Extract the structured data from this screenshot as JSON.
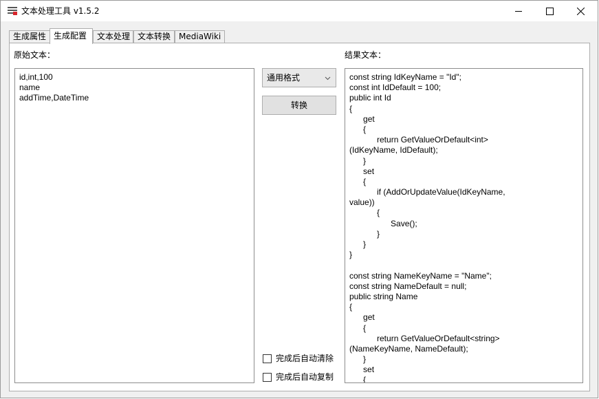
{
  "window": {
    "title": "文本处理工具 v1.5.2",
    "controls": {
      "minimize": "minimize",
      "maximize": "maximize",
      "close": "close"
    }
  },
  "tabs": [
    {
      "label": "生成属性",
      "active": false
    },
    {
      "label": "生成配置",
      "active": true
    },
    {
      "label": "文本处理",
      "active": false
    },
    {
      "label": "文本转换",
      "active": false
    },
    {
      "label": "MediaWiki",
      "active": false
    }
  ],
  "source": {
    "label": "原始文本：",
    "lines": [
      "id,int,100",
      "name",
      "addTime,DateTime"
    ]
  },
  "controls": {
    "format_select": {
      "selected": "通用格式",
      "icon": "chevron-down-icon"
    },
    "convert_button": "转换",
    "auto_clear": {
      "label": "完成后自动清除",
      "checked": false
    },
    "auto_copy": {
      "label": "完成后自动复制",
      "checked": false
    }
  },
  "result": {
    "label": "结果文本：",
    "lines": [
      "const string IdKeyName = \"Id\";",
      "const int IdDefault = 100;",
      "public int Id",
      "{",
      "\tget",
      "\t{",
      "\t\treturn GetValueOrDefault<int>",
      "(IdKeyName, IdDefault);",
      "\t}",
      "\tset",
      "\t{",
      "\t\tif (AddOrUpdateValue(IdKeyName,",
      "value))",
      "\t\t{",
      "\t\t\tSave();",
      "\t\t}",
      "\t}",
      "}",
      "",
      "const string NameKeyName = \"Name\";",
      "const string NameDefault = null;",
      "public string Name",
      "{",
      "\tget",
      "\t{",
      "\t\treturn GetValueOrDefault<string>",
      "(NameKeyName, NameDefault);",
      "\t}",
      "\tset",
      "\t{"
    ]
  }
}
